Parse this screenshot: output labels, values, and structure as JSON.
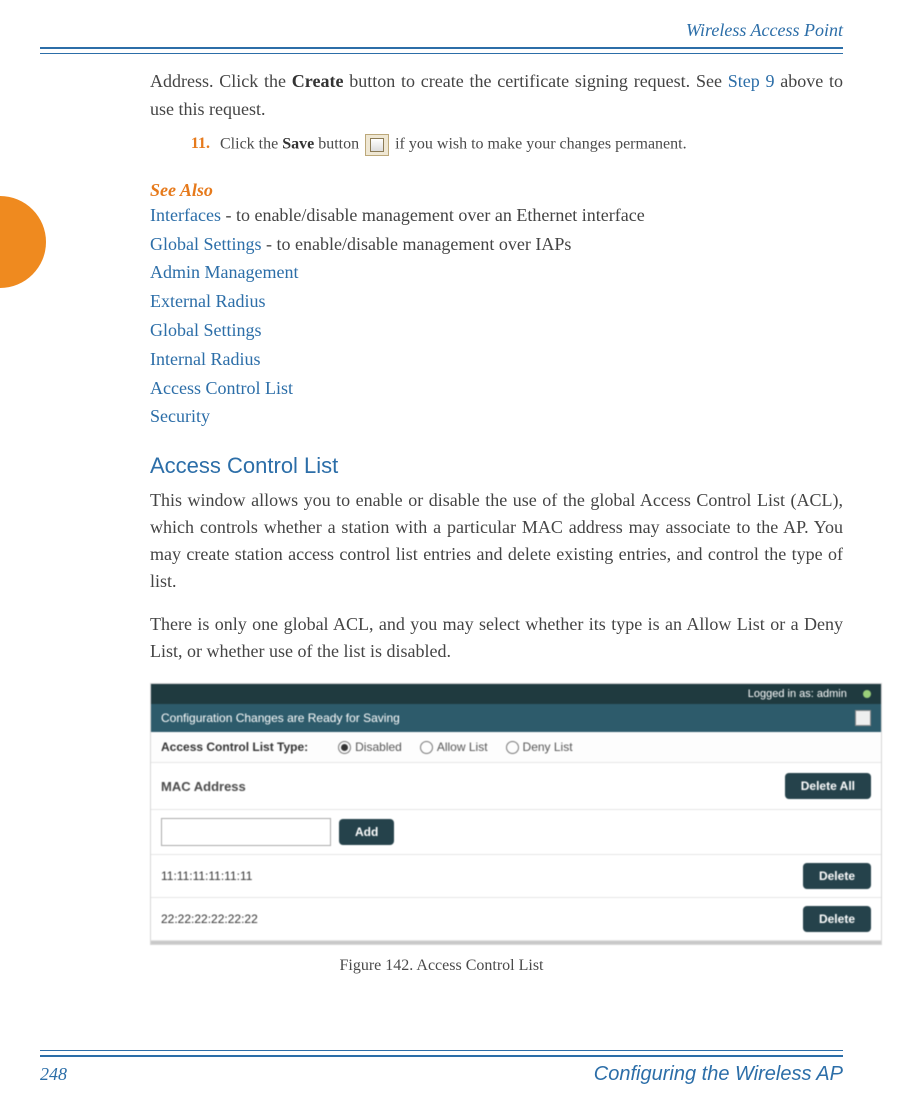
{
  "running_head": "Wireless Access Point",
  "cont_text": {
    "pre": "Address. Click the ",
    "bold1": "Create",
    "mid": " button to create the certificate signing request. See ",
    "link": "Step 9",
    "post": " above to use this request."
  },
  "step11": {
    "num": "11.",
    "pre": "Click the ",
    "bold": "Save",
    "mid": " button ",
    "post": " if you wish to make your changes permanent."
  },
  "see_also_title": "See Also",
  "see_also": {
    "r1_link": "Interfaces",
    "r1_rest": " - to enable/disable management over an Ethernet interface",
    "r2_link": "Global Settings",
    "r2_rest": " - to enable/disable management over IAPs",
    "items": [
      "Admin Management",
      "External Radius",
      "Global Settings",
      "Internal Radius",
      "Access Control List",
      "Security"
    ]
  },
  "section_title": "Access Control List",
  "para1": "This window allows you to enable or disable the use of the global Access Control List (ACL), which controls whether a station with a particular MAC address may associate to the AP. You may create station access control list entries and delete existing entries, and control the type of list.",
  "para2": "There is only one global ACL, and you may select whether its type is an Allow List or a Deny List, or whether use of the list is disabled.",
  "acl": {
    "logged_in": "Logged in as: admin",
    "banner": "Configuration Changes are Ready for Saving",
    "type_label": "Access Control List Type:",
    "opt_disabled": "Disabled",
    "opt_allow": "Allow List",
    "opt_deny": "Deny List",
    "col_mac": "MAC Address",
    "btn_delete_all": "Delete All",
    "btn_add": "Add",
    "btn_delete": "Delete",
    "rows": [
      "11:11:11:11:11:11",
      "22:22:22:22:22:22"
    ]
  },
  "figure_caption": "Figure 142. Access Control List",
  "page_number": "248",
  "footer_section": "Configuring the Wireless AP"
}
